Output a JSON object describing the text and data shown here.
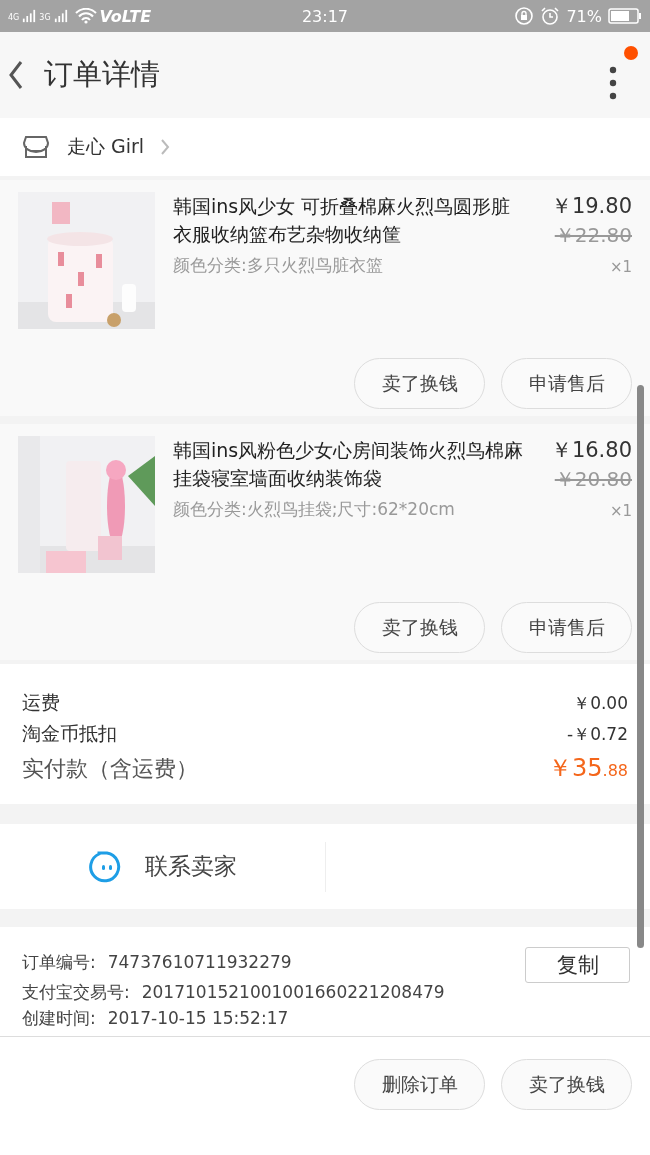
{
  "status_bar": {
    "network_1": "4G",
    "network_2": "3G",
    "volte": "VoLTE",
    "time": "23:17",
    "battery": "71%"
  },
  "header": {
    "title": "订单详情",
    "has_notification": true
  },
  "shop": {
    "name": "走心 Girl"
  },
  "items": [
    {
      "kind": "picture",
      "title": "韩国ins风少女 可折叠棉麻火烈鸟圆形脏衣服收纳篮布艺杂物收纳筐",
      "price": "￥19.80",
      "original_price": "￥22.80",
      "sku": "颜色分类:多只火烈鸟脏衣篮",
      "quantity": "×1",
      "buttons": [
        "卖了换钱",
        "申请售后"
      ]
    },
    {
      "kind": "picture",
      "title": "韩国ins风粉色少女心房间装饰火烈鸟棉麻挂袋寝室墙面收纳装饰袋",
      "price": "￥16.80",
      "original_price": "￥20.80",
      "sku": "颜色分类:火烈鸟挂袋;尺寸:62*20cm",
      "quantity": "×1",
      "buttons": [
        "卖了换钱",
        "申请售后"
      ]
    }
  ],
  "summary": [
    {
      "label": "运费",
      "value": "￥0.00"
    },
    {
      "label": "淘金币抵扣",
      "value": "-￥0.72"
    }
  ],
  "total": {
    "label": "实付款（含运费）",
    "amount": "￥35",
    "amount_decimals": ".88"
  },
  "contact": {
    "label": "联系卖家"
  },
  "order_info": [
    {
      "label": "订单编号:",
      "value": "74737610711932279"
    },
    {
      "label": "支付宝交易号:",
      "value": "2017101521001001660221208479"
    },
    {
      "label": "创建时间:",
      "value": "2017-10-15 15:52:17"
    }
  ],
  "copy_button": "复制",
  "bottom_buttons": [
    "删除订单",
    "卖了换钱"
  ]
}
